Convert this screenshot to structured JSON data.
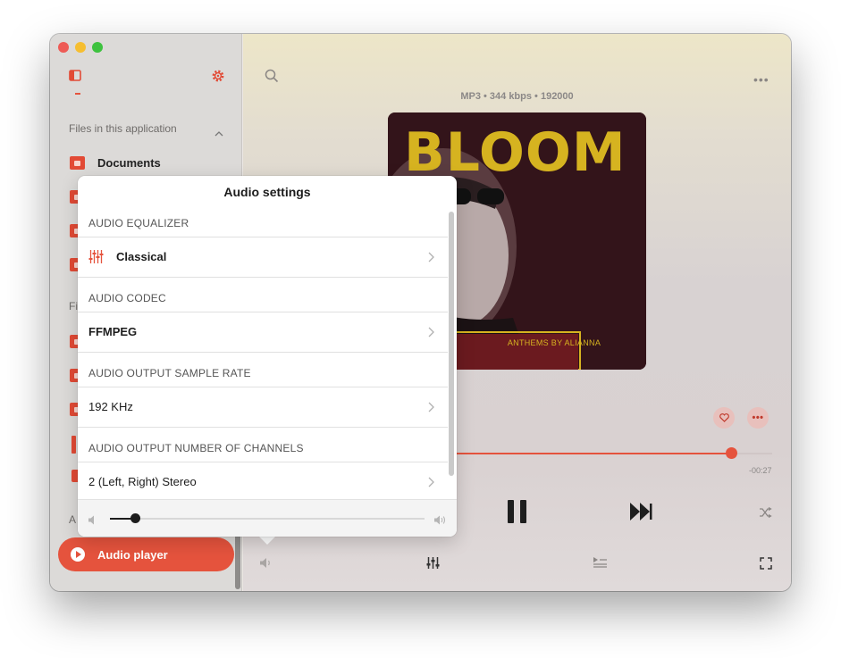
{
  "sidebar": {
    "section_files": "Files in this application",
    "item_documents": "Documents",
    "truncated_section": "Fi",
    "truncated_footer": "A",
    "audio_player": "Audio player"
  },
  "player": {
    "format": "MP3 • 344 kbps • 192000",
    "album_title": "BLOOM",
    "album_subtitle": "ANTHEMS BY ALIANNA",
    "time_remaining": "-00:27",
    "more_dots": "•••",
    "progress_fraction": 0.92,
    "colors": {
      "accent": "#e5533d",
      "album_yellow": "#d6b320",
      "album_bg": "#33141a"
    }
  },
  "audio_settings": {
    "title": "Audio settings",
    "sections": [
      {
        "header": "AUDIO EQUALIZER",
        "value": "Classical",
        "icon": "equalizer-icon"
      },
      {
        "header": "AUDIO CODEC",
        "value": "FFMPEG"
      },
      {
        "header": "AUDIO OUTPUT SAMPLE RATE",
        "value": "192 KHz"
      },
      {
        "header": "AUDIO OUTPUT NUMBER OF CHANNELS",
        "value": "2 (Left, Right) Stereo"
      }
    ],
    "volume_fraction": 0.08
  }
}
